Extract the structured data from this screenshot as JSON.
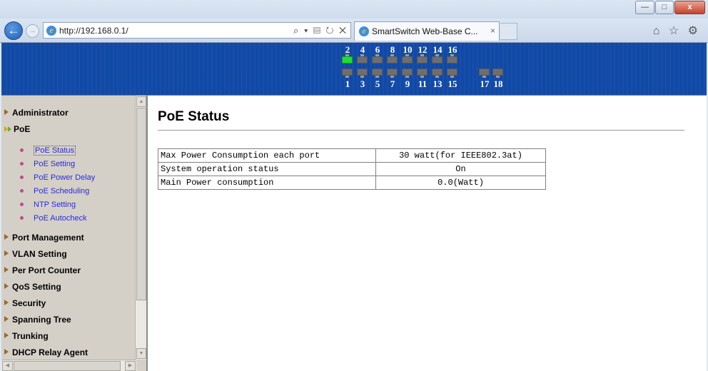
{
  "browser": {
    "url": "http://192.168.0.1/",
    "tab_title": "SmartSwitch Web-Base C...",
    "tab_close": "×",
    "address_tools": "⌕ ▾ ▤ ↻ ✕",
    "right_icons": "⌂ ☆ ⚙",
    "window_controls": {
      "minimize": "—",
      "maximize": "□",
      "close": "x"
    }
  },
  "ports": {
    "top_labels": [
      "2",
      "4",
      "6",
      "8",
      "10",
      "12",
      "14",
      "16"
    ],
    "bottom_labels": [
      "1",
      "3",
      "5",
      "7",
      "9",
      "11",
      "13",
      "15"
    ],
    "uplink_labels": [
      "17",
      "18"
    ],
    "active_ports": [
      "2"
    ]
  },
  "sidebar": {
    "items": [
      {
        "label": "Administrator",
        "expanded": false
      },
      {
        "label": "PoE",
        "expanded": true
      },
      {
        "label": "Port Management",
        "expanded": false
      },
      {
        "label": "VLAN Setting",
        "expanded": false
      },
      {
        "label": "Per Port Counter",
        "expanded": false
      },
      {
        "label": "QoS Setting",
        "expanded": false
      },
      {
        "label": "Security",
        "expanded": false
      },
      {
        "label": "Spanning Tree",
        "expanded": false
      },
      {
        "label": "Trunking",
        "expanded": false
      },
      {
        "label": "DHCP Relay Agent",
        "expanded": false
      }
    ],
    "poe_subitems": [
      {
        "label": "PoE Status",
        "active": true
      },
      {
        "label": "PoE Setting",
        "active": false
      },
      {
        "label": "PoE Power Delay",
        "active": false
      },
      {
        "label": "PoE Scheduling",
        "active": false
      },
      {
        "label": "NTP Setting",
        "active": false
      },
      {
        "label": "PoE Autocheck",
        "active": false
      }
    ]
  },
  "main": {
    "title": "PoE Status",
    "rows": [
      {
        "label": "Max Power Consumption each port",
        "value": "30 watt(for IEEE802.3at)"
      },
      {
        "label": "System operation status",
        "value": "On"
      },
      {
        "label": "Main Power consumption",
        "value": "0.0(Watt)"
      }
    ]
  }
}
